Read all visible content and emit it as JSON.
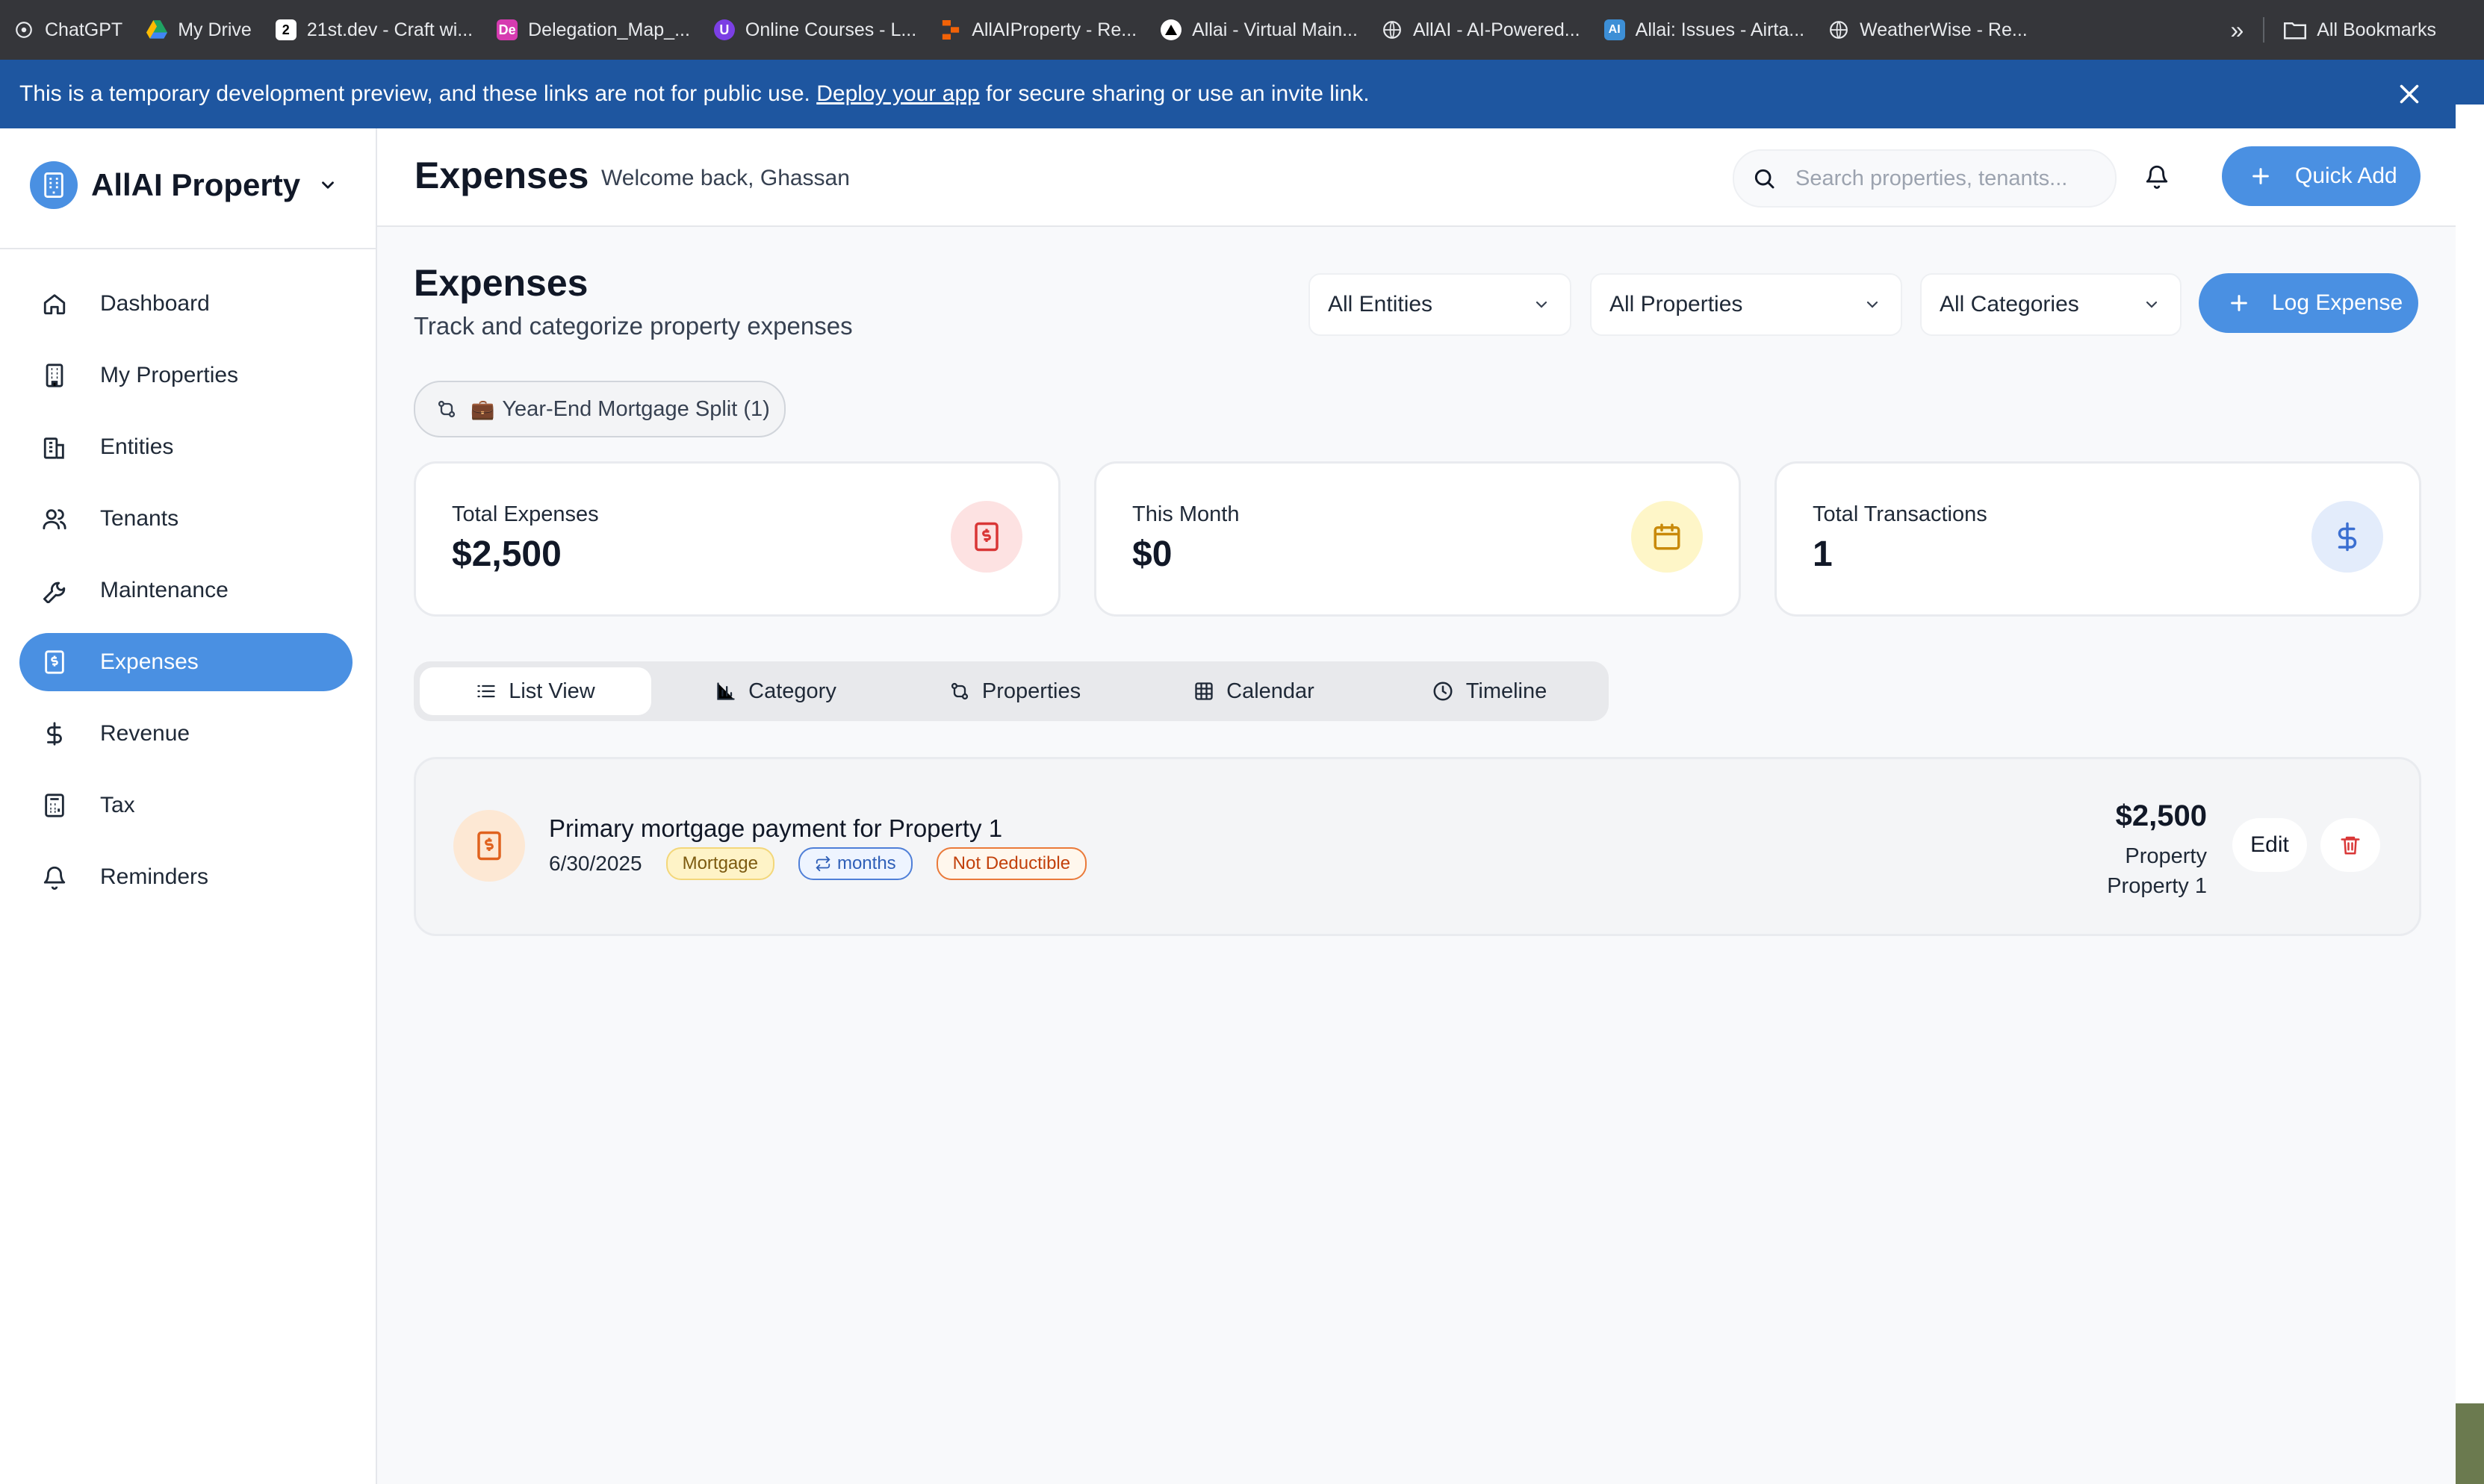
{
  "bookmarks": {
    "items": [
      {
        "label": "ChatGPT",
        "icon": "chatgpt-icon"
      },
      {
        "label": "My Drive",
        "icon": "google-drive-icon"
      },
      {
        "label": "21st.dev - Craft wi...",
        "icon": "21st-dev-icon"
      },
      {
        "label": "Delegation_Map_...",
        "icon": "de-icon"
      },
      {
        "label": "Online Courses - L...",
        "icon": "courses-icon"
      },
      {
        "label": "AllAIProperty - Re...",
        "icon": "replit-icon"
      },
      {
        "label": "Allai - Virtual Main...",
        "icon": "triangle-icon"
      },
      {
        "label": "AllAI - AI-Powered...",
        "icon": "globe-icon"
      },
      {
        "label": "Allai: Issues - Airta...",
        "icon": "ai-icon"
      },
      {
        "label": "WeatherWise - Re...",
        "icon": "globe-icon"
      }
    ],
    "overflow": "»",
    "all_bookmarks": "All Bookmarks"
  },
  "banner": {
    "text_before": "This is a temporary development preview, and these links are not for public use. ",
    "link": "Deploy your app",
    "text_after": " for secure sharing or use an invite link."
  },
  "sidebar": {
    "brand": "AllAI Property",
    "items": [
      {
        "label": "Dashboard",
        "icon": "home-icon"
      },
      {
        "label": "My Properties",
        "icon": "building-icon"
      },
      {
        "label": "Entities",
        "icon": "entities-icon"
      },
      {
        "label": "Tenants",
        "icon": "users-icon"
      },
      {
        "label": "Maintenance",
        "icon": "wrench-icon"
      },
      {
        "label": "Expenses",
        "icon": "receipt-icon",
        "active": true
      },
      {
        "label": "Revenue",
        "icon": "dollar-icon"
      },
      {
        "label": "Tax",
        "icon": "calculator-icon"
      },
      {
        "label": "Reminders",
        "icon": "bell-icon"
      }
    ]
  },
  "header": {
    "title": "Expenses",
    "welcome": "Welcome back, Ghassan",
    "search_placeholder": "Search properties, tenants...",
    "quick_add": "Quick Add"
  },
  "page": {
    "title": "Expenses",
    "subtitle": "Track and categorize property expenses",
    "filters": {
      "entities": "All Entities",
      "properties": "All Properties",
      "categories": "All Categories"
    },
    "log_expense": "Log Expense",
    "chip": {
      "emoji": "💼",
      "label": "Year-End Mortgage Split (1)"
    }
  },
  "stats": [
    {
      "label": "Total Expenses",
      "value": "$2,500",
      "icon": "receipt-icon",
      "bg": "#fde2e2",
      "fg": "#d93636"
    },
    {
      "label": "This Month",
      "value": "$0",
      "icon": "calendar-icon",
      "bg": "#fef6c8",
      "fg": "#c98a0a"
    },
    {
      "label": "Total Transactions",
      "value": "1",
      "icon": "dollar-icon",
      "bg": "#e3ecfb",
      "fg": "#3b6fd1"
    }
  ],
  "views": {
    "list": "List View",
    "category": "Category",
    "properties": "Properties",
    "calendar": "Calendar",
    "timeline": "Timeline"
  },
  "expenses": [
    {
      "title": "Primary mortgage payment for Property 1",
      "date": "6/30/2025",
      "category": "Mortgage",
      "recurrence": "months",
      "deductible": "Not Deductible",
      "amount": "$2,500",
      "property_line1": "Property",
      "property_line2": "Property 1",
      "edit": "Edit"
    }
  ]
}
